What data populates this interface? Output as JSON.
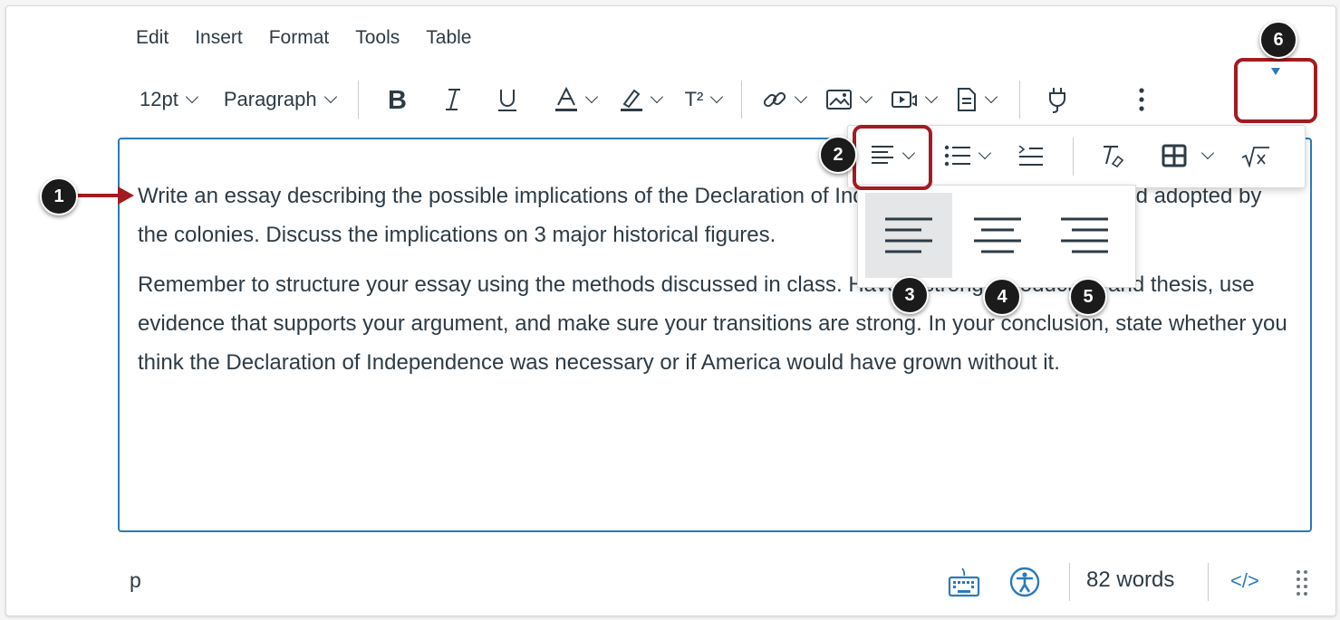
{
  "menubar": {
    "items": [
      "Edit",
      "Insert",
      "Format",
      "Tools",
      "Table"
    ]
  },
  "toolbar": {
    "font_size": "12pt",
    "block_format": "Paragraph",
    "superscript_label": "T²"
  },
  "editor": {
    "paragraphs": [
      "Write an essay describing the possible implications of the Declaration of Independence being drafted and adopted by the colonies. Discuss the implications on 3 major historical figures.",
      "Remember to structure your essay using the methods discussed in class. Have a strong introduction and thesis, use evidence that supports your argument, and make sure your transitions are strong. In your conclusion, state whether you think the Declaration of Independence was necessary or if America would have grown without it."
    ]
  },
  "statusbar": {
    "element_path": "p",
    "word_count": "82 words",
    "html_toggle": "</>"
  },
  "callouts": [
    "1",
    "2",
    "3",
    "4",
    "5",
    "6"
  ],
  "colors": {
    "accent": "#2b7abc",
    "callout_border": "#a31b22",
    "text": "#2d3b45"
  }
}
